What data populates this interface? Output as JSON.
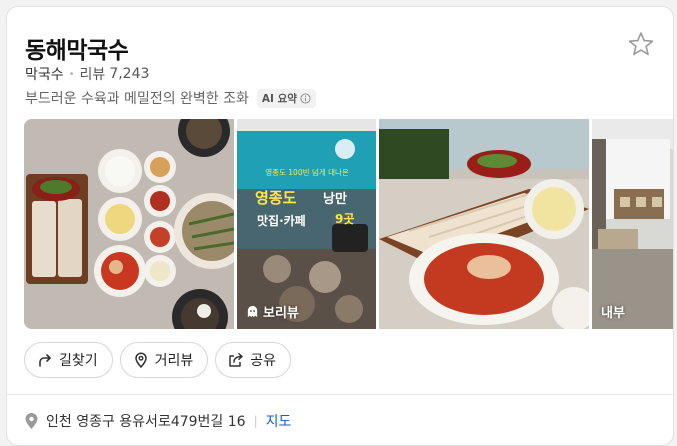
{
  "place": {
    "name": "동해막국수",
    "category": "막국수",
    "review_label": "리뷰",
    "review_count": "7,243",
    "summary": "부드러운 수육과 메밀전의 완벽한 조화",
    "ai_badge": "AI 요약"
  },
  "photos": [
    {
      "label": ""
    },
    {
      "label": "보리뷰",
      "overlay_text_1": "영종도 100빈 넘게 대나온",
      "overlay_text_2": "영종도",
      "overlay_text_3": "낭만",
      "overlay_text_4": "맛집·카페",
      "overlay_text_5": "9곳"
    },
    {
      "label": ""
    },
    {
      "label": "내부"
    }
  ],
  "actions": {
    "directions": "길찾기",
    "street_view": "거리뷰",
    "share": "공유"
  },
  "address": {
    "text": "인천 영종구 용유서로479번길 16",
    "map_link": "지도"
  },
  "icons": {
    "star": "star-outline-icon",
    "directions": "directions-arrow-icon",
    "street_view": "street-view-pin-icon",
    "share": "share-icon",
    "address": "location-pin-icon",
    "info": "info-circle-icon"
  },
  "colors": {
    "link": "#1a57d6",
    "text": "#1a1a1a",
    "muted": "#666666"
  }
}
